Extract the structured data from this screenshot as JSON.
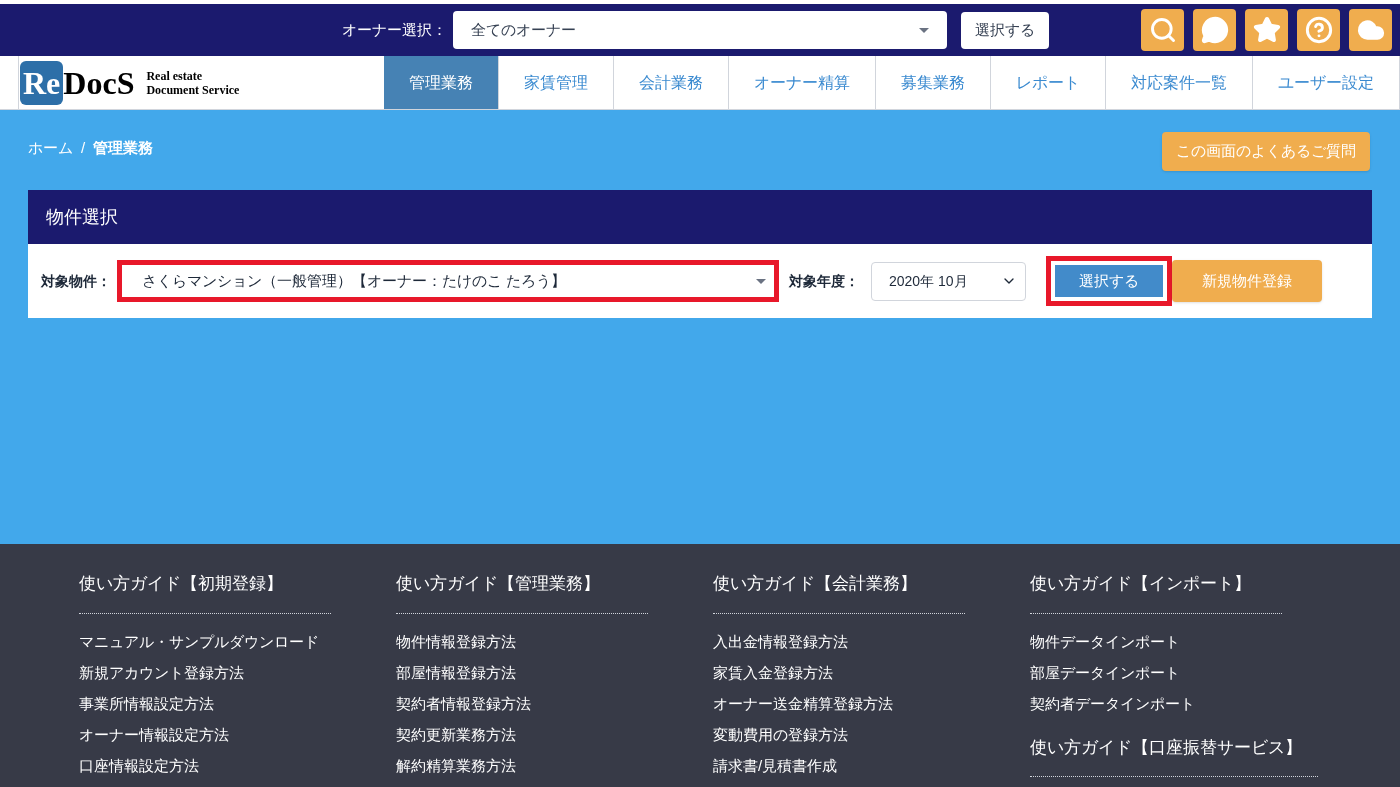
{
  "top_bar": {
    "owner_label": "オーナー選択：",
    "owner_select": "全てのオーナー",
    "select_button": "選択する",
    "icons": [
      {
        "kind": "search"
      },
      {
        "kind": "chat"
      },
      {
        "kind": "star"
      },
      {
        "kind": "help"
      },
      {
        "kind": "cloud"
      }
    ]
  },
  "logo": {
    "mark": "Re",
    "name": "DocS",
    "tagline_1": "Real estate",
    "tagline_2": "Document Service"
  },
  "nav": [
    {
      "label": "管理業務",
      "selected": true
    },
    {
      "label": "家賃管理",
      "selected": false
    },
    {
      "label": "会計業務",
      "selected": false
    },
    {
      "label": "オーナー精算",
      "selected": false
    },
    {
      "label": "募集業務",
      "selected": false
    },
    {
      "label": "レポート",
      "selected": false
    },
    {
      "label": "対応案件一覧",
      "selected": false
    },
    {
      "label": "ユーザー設定",
      "selected": false
    }
  ],
  "breadcrumb": [
    {
      "label": "ホーム",
      "current": false
    },
    {
      "label": "管理業務",
      "current": true
    }
  ],
  "breadcrumb_separator": "/",
  "faq_button": "この画面のよくあるご質問",
  "panel": {
    "title": "物件選択",
    "property_label": "対象物件：",
    "property_select": {
      "value": "さくらマンション（一般管理）【オーナー：たけのこ たろう】",
      "highlighted": true
    },
    "year_label": "対象年度：",
    "year_select": "2020年 10月",
    "select_button": {
      "label": "選択する",
      "highlighted": true
    },
    "register_button": "新規物件登録"
  },
  "footer": [
    {
      "heading": "使い方ガイド【初期登録】",
      "links": [
        "マニュアル・サンプルダウンロード",
        "新規アカウント登録方法",
        "事業所情報設定方法",
        "オーナー情報設定方法",
        "口座情報設定方法"
      ]
    },
    {
      "heading": "使い方ガイド【管理業務】",
      "links": [
        "物件情報登録方法",
        "部屋情報登録方法",
        "契約者情報登録方法",
        "契約更新業務方法",
        "解約精算業務方法"
      ]
    },
    {
      "heading": "使い方ガイド【会計業務】",
      "links": [
        "入出金情報登録方法",
        "家賃入金登録方法",
        "オーナー送金精算登録方法",
        "変動費用の登録方法",
        "請求書/見積書作成"
      ]
    },
    {
      "heading": "使い方ガイド【インポート】",
      "links": [
        "物件データインポート",
        "部屋データインポート",
        "契約者データインポート"
      ]
    },
    {
      "heading": "使い方ガイド【口座振替サービス】"
    }
  ]
}
